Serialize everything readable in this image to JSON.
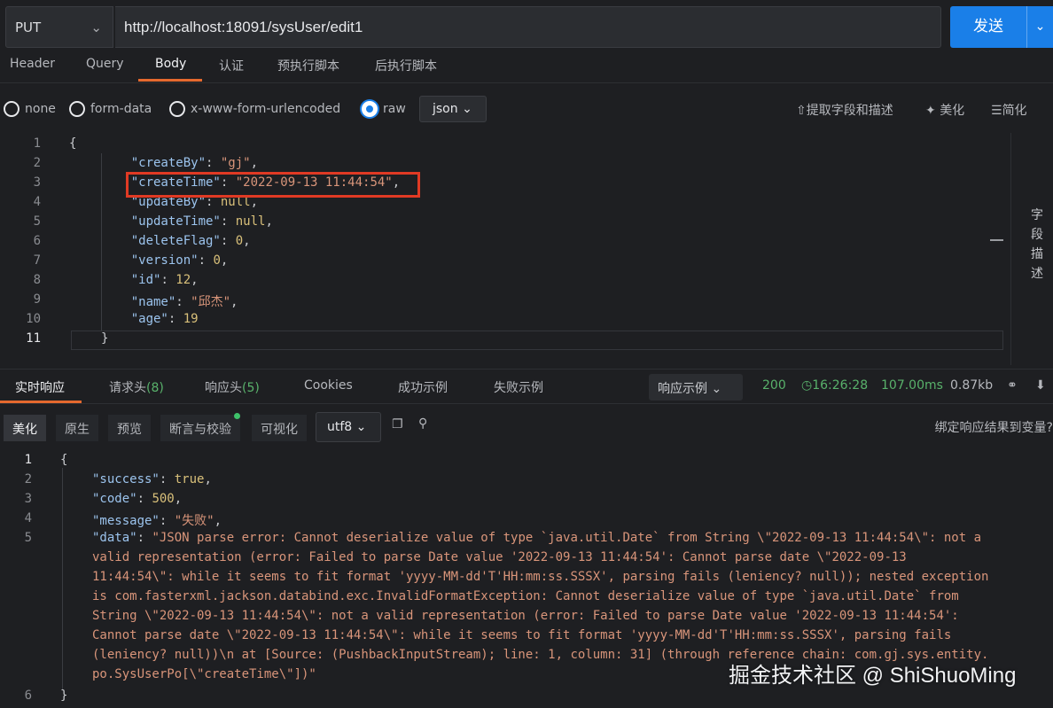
{
  "request": {
    "method": "PUT",
    "url": "http://localhost:18091/sysUser/edit1",
    "send_label": "发送"
  },
  "request_tabs": [
    "Header",
    "Query",
    "Body",
    "认证",
    "预执行脚本",
    "后执行脚本"
  ],
  "body_types": [
    "none",
    "form-data",
    "x-www-form-urlencoded",
    "raw"
  ],
  "body_format": "json",
  "body_tools": {
    "extract": "提取字段和描述",
    "beautify": "美化",
    "simplify": "简化"
  },
  "side_panel_label": [
    "字",
    "段",
    "描",
    "述"
  ],
  "request_body_lines": [
    "{",
    "    \"createBy\": \"gj\",",
    "    \"createTime\": \"2022-09-13 11:44:54\",",
    "    \"updateBy\": null,",
    "    \"updateTime\": null,",
    "    \"deleteFlag\": 0,",
    "    \"version\": 0,",
    "    \"id\": 12,",
    "    \"name\": \"邱杰\",",
    "    \"age\": 19",
    "}"
  ],
  "response_tabs": {
    "realtime": "实时响应",
    "req_headers": "请求头",
    "req_headers_count": "(8)",
    "resp_headers": "响应头",
    "resp_headers_count": "(5)",
    "cookies": "Cookies",
    "success_example": "成功示例",
    "fail_example": "失败示例"
  },
  "response_meta": {
    "example_select": "响应示例",
    "status": "200",
    "time": "16:26:28",
    "duration": "107.00ms",
    "size": "0.87kb"
  },
  "response_view_tabs": [
    "美化",
    "原生",
    "预览",
    "断言与校验",
    "可视化"
  ],
  "encoding": "utf8",
  "bind_label": "绑定响应结果到变量?",
  "response_body": {
    "l1": "{",
    "success_key": "\"success\"",
    "success_val": "true",
    "code_key": "\"code\"",
    "code_val": "500",
    "message_key": "\"message\"",
    "message_val": "\"失败\"",
    "data_key": "\"data\"",
    "data_lines": [
      "\"JSON parse error: Cannot deserialize value of type `java.util.Date` from String \\\"2022-09-13 11:44:54\\\": not a",
      "valid representation (error: Failed to parse Date value '2022-09-13 11:44:54': Cannot parse date \\\"2022-09-13",
      "11:44:54\\\": while it seems to fit format 'yyyy-MM-dd'T'HH:mm:ss.SSSX', parsing fails (leniency? null)); nested exception",
      "is com.fasterxml.jackson.databind.exc.InvalidFormatException: Cannot deserialize value of type `java.util.Date` from",
      "String \\\"2022-09-13 11:44:54\\\": not a valid representation (error: Failed to parse Date value '2022-09-13 11:44:54':",
      "Cannot parse date \\\"2022-09-13 11:44:54\\\": while it seems to fit format 'yyyy-MM-dd'T'HH:mm:ss.SSSX', parsing fails",
      "(leniency? null))\\n at [Source: (PushbackInputStream); line: 1, column: 31] (through reference chain: com.gj.sys.entity.",
      "po.SysUserPo[\\\"createTime\\\"])\""
    ],
    "l6": "}"
  },
  "watermark": "掘金技术社区 @ ShiShuoMing",
  "colors": {
    "accent": "#1a7fe8",
    "tab_underline": "#e5692e",
    "highlight_box": "#e03a24",
    "status_ok": "#59b26b"
  }
}
